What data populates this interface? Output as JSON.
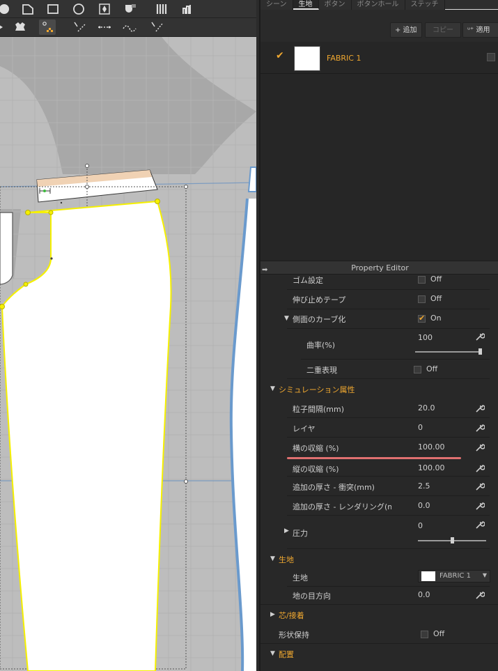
{
  "tabs": [
    {
      "label": "シーン"
    },
    {
      "label": "生地",
      "active": true
    },
    {
      "label": "ボタン"
    },
    {
      "label": "ボタンホール"
    },
    {
      "label": "ステッチ"
    }
  ],
  "fabric_bar": {
    "add_label": "+ 追加",
    "copy_label": "コピー",
    "apply_label": "ᵘ⁺ 適用"
  },
  "fabric_list": [
    {
      "name": "FABRIC 1",
      "checked": true,
      "swatch_color": "#ffffff"
    }
  ],
  "property_editor": {
    "title": "Property Editor",
    "rows": {
      "gomu": {
        "label": "ゴム設定",
        "value": "Off"
      },
      "nobidome": {
        "label": "伸び止めテープ",
        "value": "Off"
      },
      "sokumen": {
        "label": "側面のカーブ化",
        "value": "On"
      },
      "kyokuritsu": {
        "label": "曲率(%)",
        "value": "100",
        "slider": 1.0
      },
      "nijuu": {
        "label": "二重表現",
        "value": "Off"
      },
      "sim_section": {
        "label": "シミュレーション属性"
      },
      "ryushi": {
        "label": "粒子間隔(mm)",
        "value": "20.0"
      },
      "layer": {
        "label": "レイヤ",
        "value": "0"
      },
      "yoko": {
        "label": "横の収縮 (%)",
        "value": "100.00"
      },
      "tate": {
        "label": "縦の収縮 (%)",
        "value": "100.00"
      },
      "atsusa_shototsu": {
        "label": "追加の厚さ - 衝突(mm)",
        "value": "2.5"
      },
      "atsusa_render": {
        "label": "追加の厚さ - レンダリング(mm)",
        "value": "0.0"
      },
      "atsuryoku": {
        "label": "圧力",
        "value": "0",
        "slider": 0.5
      },
      "kiji_section": {
        "label": "生地"
      },
      "kiji": {
        "label": "生地",
        "value": "FABRIC 1"
      },
      "jinome": {
        "label": "地の目方向",
        "value": "0.0"
      },
      "shin_section": {
        "label": "芯/接着"
      },
      "keijo": {
        "label": "形状保持",
        "value": "Off"
      },
      "haichi_section": {
        "label": "配置"
      }
    }
  },
  "colors": {
    "accent": "#f0a830",
    "pattern_outline": "#f5f000",
    "underline": "#e07070",
    "avatar_line": "#6a9acd"
  }
}
